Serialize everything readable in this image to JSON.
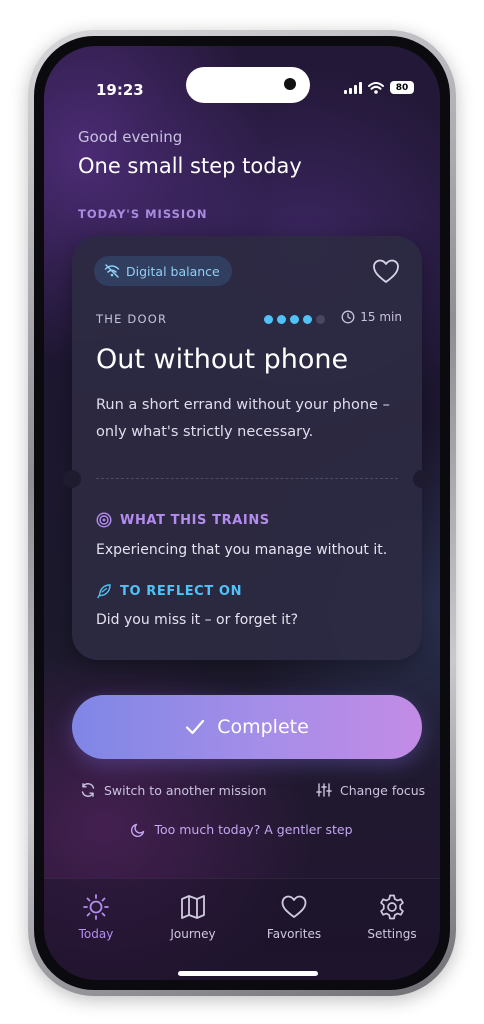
{
  "status_bar": {
    "time": "19:23",
    "battery": "80"
  },
  "header": {
    "greeting": "Good evening",
    "headline": "One small step today",
    "section_label": "TODAY'S MISSION"
  },
  "mission": {
    "tag": "Digital balance",
    "category": "THE DOOR",
    "difficulty": {
      "filled": 4,
      "total": 5
    },
    "duration": "15 min",
    "title": "Out without phone",
    "description": "Run a short errand without your phone – only what's strictly necessary.",
    "trains_heading": "WHAT THIS TRAINS",
    "trains_text": "Experiencing that you manage without it.",
    "reflect_heading": "TO REFLECT ON",
    "reflect_text": "Did you miss it – or forget it?"
  },
  "actions": {
    "complete": "Complete",
    "switch": "Switch to another mission",
    "change_focus": "Change focus",
    "gentler": "Too much today? A gentler step"
  },
  "tabs": [
    {
      "label": "Today",
      "icon": "sun-icon",
      "active": true
    },
    {
      "label": "Journey",
      "icon": "map-icon",
      "active": false
    },
    {
      "label": "Favorites",
      "icon": "heart-icon",
      "active": false
    },
    {
      "label": "Settings",
      "icon": "gear-icon",
      "active": false
    }
  ],
  "colors": {
    "accent_purple": "#a98be0",
    "accent_blue": "#4fc3f7",
    "dot_inactive": "#4a4760",
    "tab_active": "#b48cf0"
  }
}
